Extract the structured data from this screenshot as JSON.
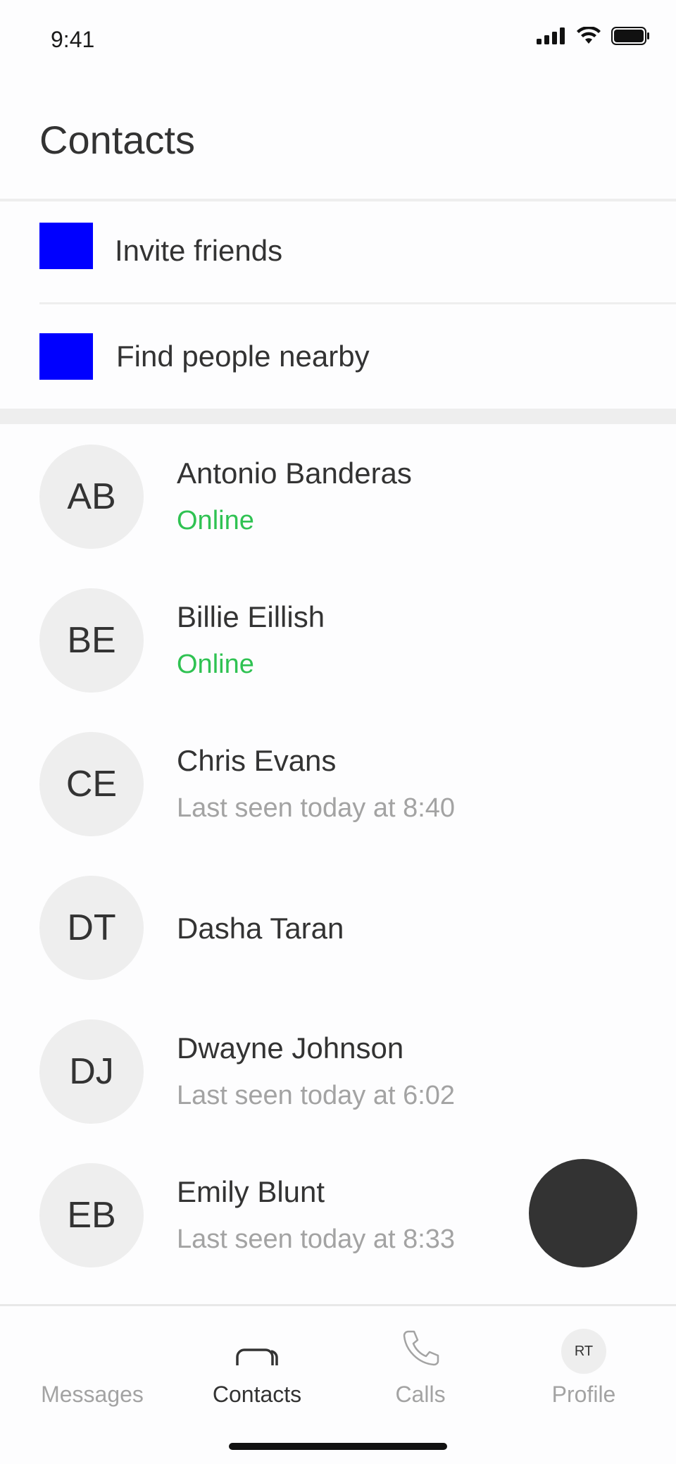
{
  "status_bar": {
    "time": "9:41"
  },
  "header": {
    "title": "Contacts"
  },
  "actions": [
    {
      "label": "Invite friends",
      "icon": "invite-icon",
      "icon_color": "#0000ff"
    },
    {
      "label": "Find people nearby",
      "icon": "nearby-icon",
      "icon_color": "#0000ff"
    }
  ],
  "contacts": [
    {
      "initials": "AB",
      "name": "Antonio Banderas",
      "status": "Online",
      "status_type": "online"
    },
    {
      "initials": "BE",
      "name": "Billie Eillish",
      "status": "Online",
      "status_type": "online"
    },
    {
      "initials": "CE",
      "name": "Chris Evans",
      "status": "Last seen today at 8:40",
      "status_type": "seen"
    },
    {
      "initials": "DT",
      "name": "Dasha Taran",
      "status": "",
      "status_type": "none"
    },
    {
      "initials": "DJ",
      "name": "Dwayne Johnson",
      "status": "Last seen today at 6:02",
      "status_type": "seen"
    },
    {
      "initials": "EB",
      "name": "Emily Blunt",
      "status": "Last seen today at 8:33",
      "status_type": "seen"
    }
  ],
  "nav": {
    "messages": "Messages",
    "contacts": "Contacts",
    "calls": "Calls",
    "profile": "Profile",
    "profile_initials": "RT",
    "active": "contacts"
  },
  "colors": {
    "accent_online": "#2fc252",
    "muted": "#a3a3a3",
    "fab": "#333333",
    "action_icon": "#0000ff"
  }
}
